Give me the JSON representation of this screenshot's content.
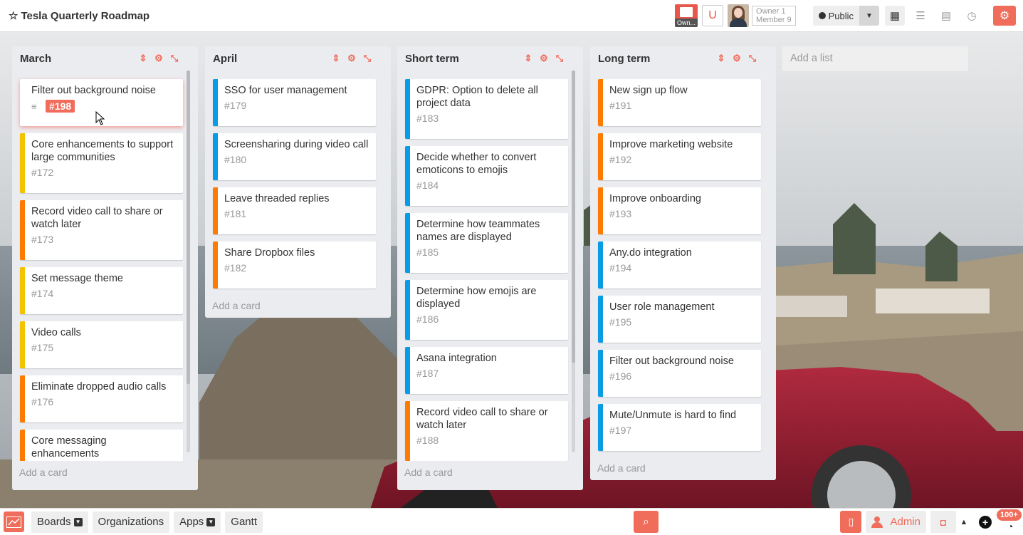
{
  "board": {
    "title": "Tesla Quarterly Roadmap",
    "star_icon": "star-icon"
  },
  "header": {
    "own_label": "Own...",
    "u_label": "U",
    "roles": {
      "owner": "Owner 1",
      "member": "Member 9"
    },
    "visibility": "Public",
    "views": [
      "grid-view-icon",
      "list-view-icon",
      "calendar-icon",
      "clock-icon"
    ],
    "settings_icon": "gear-icon"
  },
  "lists": [
    {
      "title": "March",
      "add_card": "Add a card",
      "cards": [
        {
          "title": "Filter out background noise",
          "id": "#198",
          "color": "none",
          "selected": true
        },
        {
          "title": "Core enhancements to support large communities",
          "id": "#172",
          "color": "#f2c300"
        },
        {
          "title": "Record video call to share or watch later",
          "id": "#173",
          "color": "#ff7a00"
        },
        {
          "title": "Set message theme",
          "id": "#174",
          "color": "#f2c300"
        },
        {
          "title": "Video calls",
          "id": "#175",
          "color": "#f2c300"
        },
        {
          "title": "Eliminate dropped audio calls",
          "id": "#176",
          "color": "#ff7a00"
        },
        {
          "title": "Core messaging enhancements",
          "id": "",
          "color": "#ff7a00"
        }
      ]
    },
    {
      "title": "April",
      "add_card": "Add a card",
      "cards": [
        {
          "title": "SSO for user management",
          "id": "#179",
          "color": "#0a9be6"
        },
        {
          "title": "Screensharing during video call",
          "id": "#180",
          "color": "#0a9be6"
        },
        {
          "title": "Leave threaded replies",
          "id": "#181",
          "color": "#ff7a00"
        },
        {
          "title": "Share Dropbox files",
          "id": "#182",
          "color": "#ff7a00"
        }
      ]
    },
    {
      "title": "Short term",
      "add_card": "Add a card",
      "cards": [
        {
          "title": "GDPR: Option to delete all project data",
          "id": "#183",
          "color": "#0a9be6"
        },
        {
          "title": "Decide whether to convert emoticons to emojis",
          "id": "#184",
          "color": "#0a9be6"
        },
        {
          "title": "Determine how teammates names are displayed",
          "id": "#185",
          "color": "#0a9be6"
        },
        {
          "title": "Determine how emojis are displayed",
          "id": "#186",
          "color": "#0a9be6"
        },
        {
          "title": "Asana integration",
          "id": "#187",
          "color": "#0a9be6"
        },
        {
          "title": "Record video call to share or watch later",
          "id": "#188",
          "color": "#ff7a00"
        }
      ]
    },
    {
      "title": "Long term",
      "add_card": "Add a card",
      "cards": [
        {
          "title": "New sign up flow",
          "id": "#191",
          "color": "#ff7a00"
        },
        {
          "title": "Improve marketing website",
          "id": "#192",
          "color": "#ff7a00"
        },
        {
          "title": "Improve onboarding",
          "id": "#193",
          "color": "#ff7a00"
        },
        {
          "title": "Any.do integration",
          "id": "#194",
          "color": "#0a9be6"
        },
        {
          "title": "User role management",
          "id": "#195",
          "color": "#0a9be6"
        },
        {
          "title": "Filter out background noise",
          "id": "#196",
          "color": "#0a9be6"
        },
        {
          "title": "Mute/Unmute is hard to find",
          "id": "#197",
          "color": "#0a9be6"
        }
      ]
    }
  ],
  "add_list": "Add a list",
  "footer": {
    "boards": "Boards",
    "organizations": "Organizations",
    "apps": "Apps",
    "gantt": "Gantt",
    "admin": "Admin",
    "notification_count": "100+"
  },
  "colors": {
    "accent": "#f06c5b",
    "orange": "#ff7a00",
    "blue": "#0a9be6",
    "yellow": "#f2c300"
  }
}
